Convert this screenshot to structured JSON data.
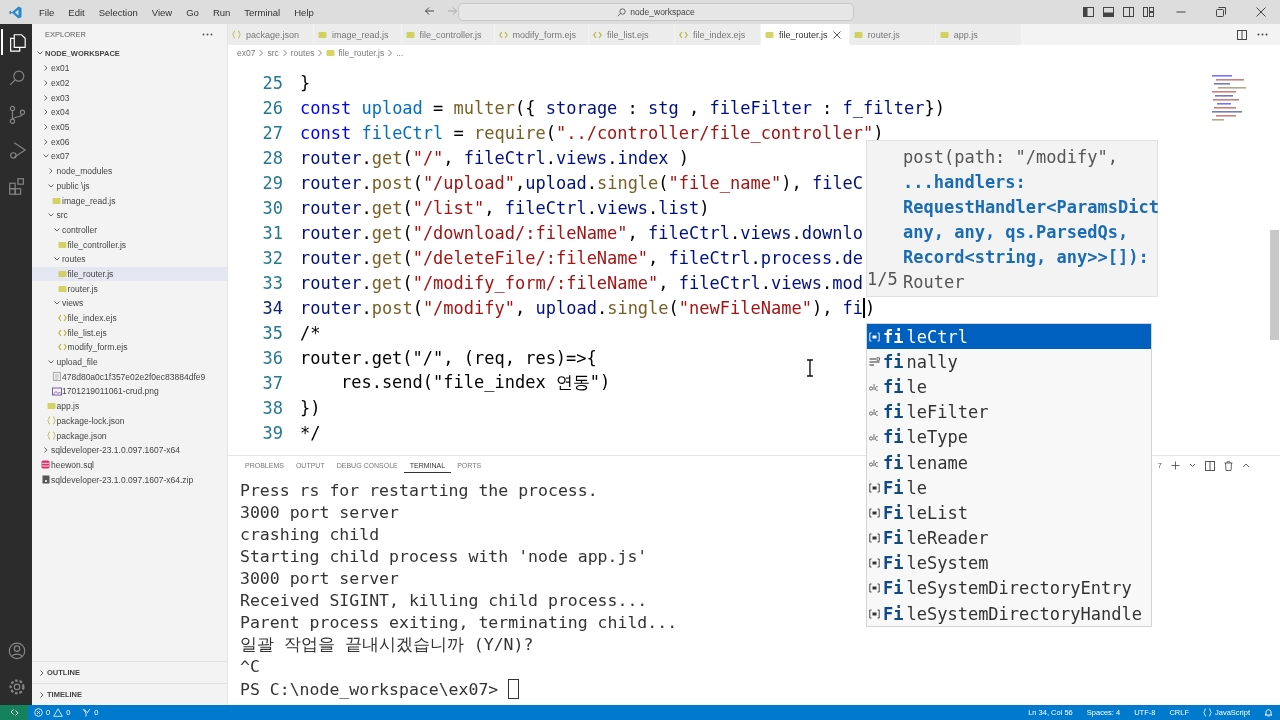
{
  "title_bar": {
    "menu": [
      "File",
      "Edit",
      "Selection",
      "View",
      "Go",
      "Run",
      "Terminal",
      "Help"
    ],
    "search": {
      "value": "node_workspace"
    }
  },
  "activity_bar": {
    "items": [
      {
        "kind": "explorer",
        "selected": true
      },
      {
        "kind": "search",
        "selected": false
      },
      {
        "kind": "source_control",
        "selected": false
      },
      {
        "kind": "run",
        "selected": false
      },
      {
        "kind": "extensions",
        "selected": false
      }
    ],
    "bottom": [
      {
        "kind": "account"
      },
      {
        "kind": "settings"
      }
    ]
  },
  "sidebar": {
    "title": "EXPLORER",
    "root": {
      "label": "NODE_WORKSPACE",
      "expanded": true
    },
    "tree": [
      {
        "label": "ex01",
        "kind": "folder",
        "expanded": false,
        "selected": false
      },
      {
        "label": "ex02",
        "kind": "folder",
        "expanded": false,
        "selected": false
      },
      {
        "label": "ex03",
        "kind": "folder",
        "expanded": false,
        "selected": false
      },
      {
        "label": "ex04",
        "kind": "folder",
        "expanded": false,
        "selected": false
      },
      {
        "label": "ex05",
        "kind": "folder",
        "expanded": false,
        "selected": false
      },
      {
        "label": "ex06",
        "kind": "folder",
        "expanded": false,
        "selected": false
      },
      {
        "label": "ex07",
        "kind": "folder",
        "expanded": true,
        "selected": false,
        "children": [
          {
            "label": "node_modules",
            "kind": "folder",
            "expanded": false,
            "selected": false
          },
          {
            "label": "public \\js",
            "kind": "folder",
            "expanded": true,
            "selected": false,
            "children": [
              {
                "label": "image_read.js",
                "kind": "js",
                "selected": false
              }
            ]
          },
          {
            "label": "src",
            "kind": "folder",
            "expanded": true,
            "selected": false,
            "children": [
              {
                "label": "controller",
                "kind": "folder",
                "expanded": true,
                "selected": false,
                "children": [
                  {
                    "label": "file_controller.js",
                    "kind": "js",
                    "selected": false
                  }
                ]
              },
              {
                "label": "routes",
                "kind": "folder",
                "expanded": true,
                "selected": false,
                "children": [
                  {
                    "label": "file_router.js",
                    "kind": "js",
                    "selected": true
                  },
                  {
                    "label": "router.js",
                    "kind": "js",
                    "selected": false
                  }
                ]
              },
              {
                "label": "views",
                "kind": "folder",
                "expanded": true,
                "selected": false,
                "children": [
                  {
                    "label": "file_index.ejs",
                    "kind": "ejs",
                    "selected": false
                  },
                  {
                    "label": "file_list.ejs",
                    "kind": "ejs",
                    "selected": false
                  },
                  {
                    "label": "modify_form.ejs",
                    "kind": "ejs",
                    "selected": false
                  }
                ]
              }
            ]
          },
          {
            "label": "upload_file",
            "kind": "folder",
            "expanded": true,
            "selected": false,
            "children": [
              {
                "label": "478d80a0c1f357e02e2f0ec83884dfe9",
                "kind": "text",
                "selected": false
              },
              {
                "label": "1701219011061-crud.png",
                "kind": "image",
                "selected": false
              }
            ]
          },
          {
            "label": "app.js",
            "kind": "js",
            "selected": false
          },
          {
            "label": "package-lock.json",
            "kind": "json",
            "selected": false
          },
          {
            "label": "package.json",
            "kind": "json",
            "selected": false
          }
        ]
      },
      {
        "label": "sqldeveloper-23.1.0.097.1607-x64",
        "kind": "folder",
        "expanded": false,
        "selected": false
      },
      {
        "label": "heewon.sql",
        "kind": "sql",
        "selected": false
      },
      {
        "label": "sqldeveloper-23.1.0.097.1607-x64.zip",
        "kind": "zip",
        "selected": false
      }
    ],
    "sections": [
      {
        "label": "OUTLINE",
        "expanded": false
      },
      {
        "label": "TIMELINE",
        "expanded": false
      }
    ]
  },
  "tabs": [
    {
      "label": "package.json",
      "kind": "json",
      "selected": false
    },
    {
      "label": "image_read.js",
      "kind": "js",
      "selected": false
    },
    {
      "label": "file_controller.js",
      "kind": "js",
      "selected": false
    },
    {
      "label": "modify_form.ejs",
      "kind": "ejs",
      "selected": false
    },
    {
      "label": "file_list.ejs",
      "kind": "ejs",
      "selected": false
    },
    {
      "label": "file_index.ejs",
      "kind": "ejs",
      "selected": false
    },
    {
      "label": "file_router.js",
      "kind": "js",
      "selected": true
    },
    {
      "label": "router.js",
      "kind": "js",
      "selected": false
    },
    {
      "label": "app.js",
      "kind": "js",
      "selected": false
    }
  ],
  "breadcrumb": [
    {
      "label": "ex07",
      "kind": "folder"
    },
    {
      "label": "src",
      "kind": "folder"
    },
    {
      "label": "routes",
      "kind": "folder"
    },
    {
      "label": "file_router.js",
      "kind": "js"
    },
    {
      "label": "...",
      "kind": "more"
    }
  ],
  "editor": {
    "lines": [
      {
        "number": "25",
        "tokens": [
          {
            "kind": "p",
            "text": "}"
          }
        ]
      },
      {
        "number": "26",
        "tokens": [
          {
            "kind": "kw",
            "text": "const"
          },
          {
            "kind": "var",
            "text": " upload"
          },
          {
            "kind": "p",
            "text": " = "
          },
          {
            "kind": "fn",
            "text": "multer"
          },
          {
            "kind": "p",
            "text": "({ "
          },
          {
            "kind": "prop",
            "text": "storage"
          },
          {
            "kind": "p",
            "text": " : "
          },
          {
            "kind": "prop",
            "text": "stg"
          },
          {
            "kind": "p",
            "text": " , "
          },
          {
            "kind": "prop",
            "text": "fileFilter"
          },
          {
            "kind": "p",
            "text": " : "
          },
          {
            "kind": "prop",
            "text": "f_filter"
          },
          {
            "kind": "p",
            "text": "})"
          }
        ]
      },
      {
        "number": "27",
        "tokens": [
          {
            "kind": "kw",
            "text": "const"
          },
          {
            "kind": "var",
            "text": " fileCtrl"
          },
          {
            "kind": "p",
            "text": " = "
          },
          {
            "kind": "fn",
            "text": "require"
          },
          {
            "kind": "p",
            "text": "("
          },
          {
            "kind": "str",
            "text": "\"../controller/file_controller\""
          },
          {
            "kind": "p",
            "text": ")"
          }
        ]
      },
      {
        "number": "28",
        "tokens": [
          {
            "kind": "prop",
            "text": "router"
          },
          {
            "kind": "p",
            "text": "."
          },
          {
            "kind": "fn",
            "text": "get"
          },
          {
            "kind": "p",
            "text": "("
          },
          {
            "kind": "str",
            "text": "\"/\""
          },
          {
            "kind": "p",
            "text": ", "
          },
          {
            "kind": "prop",
            "text": "fileCtrl"
          },
          {
            "kind": "p",
            "text": "."
          },
          {
            "kind": "prop",
            "text": "views"
          },
          {
            "kind": "p",
            "text": "."
          },
          {
            "kind": "prop",
            "text": "index"
          },
          {
            "kind": "p",
            "text": " )"
          }
        ]
      },
      {
        "number": "29",
        "tokens": [
          {
            "kind": "prop",
            "text": "router"
          },
          {
            "kind": "p",
            "text": "."
          },
          {
            "kind": "fn",
            "text": "post"
          },
          {
            "kind": "p",
            "text": "("
          },
          {
            "kind": "str",
            "text": "\"/upload\""
          },
          {
            "kind": "p",
            "text": ","
          },
          {
            "kind": "prop",
            "text": "upload"
          },
          {
            "kind": "p",
            "text": "."
          },
          {
            "kind": "fn",
            "text": "single"
          },
          {
            "kind": "p",
            "text": "("
          },
          {
            "kind": "str",
            "text": "\"file_name\""
          },
          {
            "kind": "p",
            "text": "), "
          },
          {
            "kind": "prop",
            "text": "fileC"
          }
        ]
      },
      {
        "number": "30",
        "tokens": [
          {
            "kind": "prop",
            "text": "router"
          },
          {
            "kind": "p",
            "text": "."
          },
          {
            "kind": "fn",
            "text": "get"
          },
          {
            "kind": "p",
            "text": "("
          },
          {
            "kind": "str",
            "text": "\"/list\""
          },
          {
            "kind": "p",
            "text": ", "
          },
          {
            "kind": "prop",
            "text": "fileCtrl"
          },
          {
            "kind": "p",
            "text": "."
          },
          {
            "kind": "prop",
            "text": "views"
          },
          {
            "kind": "p",
            "text": "."
          },
          {
            "kind": "prop",
            "text": "list"
          },
          {
            "kind": "p",
            "text": ")"
          }
        ]
      },
      {
        "number": "31",
        "tokens": [
          {
            "kind": "prop",
            "text": "router"
          },
          {
            "kind": "p",
            "text": "."
          },
          {
            "kind": "fn",
            "text": "get"
          },
          {
            "kind": "p",
            "text": "("
          },
          {
            "kind": "str",
            "text": "\"/download/:fileName\""
          },
          {
            "kind": "p",
            "text": ", "
          },
          {
            "kind": "prop",
            "text": "fileCtrl"
          },
          {
            "kind": "p",
            "text": "."
          },
          {
            "kind": "prop",
            "text": "views"
          },
          {
            "kind": "p",
            "text": "."
          },
          {
            "kind": "prop",
            "text": "downlo"
          }
        ]
      },
      {
        "number": "32",
        "tokens": [
          {
            "kind": "prop",
            "text": "router"
          },
          {
            "kind": "p",
            "text": "."
          },
          {
            "kind": "fn",
            "text": "get"
          },
          {
            "kind": "p",
            "text": "("
          },
          {
            "kind": "str",
            "text": "\"/deleteFile/:fileName\""
          },
          {
            "kind": "p",
            "text": ", "
          },
          {
            "kind": "prop",
            "text": "fileCtrl"
          },
          {
            "kind": "p",
            "text": "."
          },
          {
            "kind": "prop",
            "text": "process"
          },
          {
            "kind": "p",
            "text": "."
          },
          {
            "kind": "prop",
            "text": "de"
          }
        ]
      },
      {
        "number": "33",
        "tokens": [
          {
            "kind": "prop",
            "text": "router"
          },
          {
            "kind": "p",
            "text": "."
          },
          {
            "kind": "fn",
            "text": "get"
          },
          {
            "kind": "p",
            "text": "("
          },
          {
            "kind": "str",
            "text": "\"/modify_form/:fileName\""
          },
          {
            "kind": "p",
            "text": ", "
          },
          {
            "kind": "prop",
            "text": "fileCtrl"
          },
          {
            "kind": "p",
            "text": "."
          },
          {
            "kind": "prop",
            "text": "views"
          },
          {
            "kind": "p",
            "text": "."
          },
          {
            "kind": "prop",
            "text": "mod"
          }
        ]
      },
      {
        "number": "34",
        "tokens": [
          {
            "kind": "prop",
            "text": "router"
          },
          {
            "kind": "p",
            "text": "."
          },
          {
            "kind": "fn",
            "text": "post"
          },
          {
            "kind": "p",
            "text": "("
          },
          {
            "kind": "str",
            "text": "\"/modify\""
          },
          {
            "kind": "p",
            "text": ", "
          },
          {
            "kind": "prop",
            "text": "upload"
          },
          {
            "kind": "p",
            "text": "."
          },
          {
            "kind": "fn",
            "text": "single"
          },
          {
            "kind": "p",
            "text": "("
          },
          {
            "kind": "str",
            "text": "\"newFileName\""
          },
          {
            "kind": "p",
            "text": "), "
          },
          {
            "kind": "prop",
            "text": "fi",
            "caret": true
          },
          {
            "kind": "p",
            "text": ")"
          }
        ]
      },
      {
        "number": "35",
        "tokens": [
          {
            "kind": "p",
            "text": "/*"
          }
        ]
      },
      {
        "number": "36",
        "tokens": [
          {
            "kind": "p",
            "text": "router.get(\"/\", (req, res)=>{"
          }
        ]
      },
      {
        "number": "37",
        "tokens": [
          {
            "kind": "p",
            "text": "    res.send(\"file_index 연동\")"
          }
        ]
      },
      {
        "number": "38",
        "tokens": [
          {
            "kind": "p",
            "text": "})"
          }
        ]
      },
      {
        "number": "39",
        "tokens": [
          {
            "kind": "p",
            "text": "*/"
          }
        ]
      }
    ]
  },
  "hover": {
    "counter": "1/5",
    "lines": [
      {
        "kind": "plain",
        "text": "post(path: \"/modify\","
      },
      {
        "kind": "param",
        "text": "...handlers:"
      },
      {
        "kind": "param",
        "text": "RequestHandler<ParamsDict"
      },
      {
        "kind": "param",
        "text": "any, any, qs.ParsedQs,"
      },
      {
        "kind": "param",
        "text": "Record<string, any>>[]):"
      },
      {
        "kind": "plain",
        "text": "Router"
      }
    ]
  },
  "suggestions": [
    {
      "label": "**fi**leCtrl",
      "kind": "variable",
      "selected": true
    },
    {
      "label": "**fi**nally",
      "kind": "keyword",
      "selected": false
    },
    {
      "label": "**fi**le",
      "kind": "word",
      "selected": false
    },
    {
      "label": "**fi**leFilter",
      "kind": "word",
      "selected": false
    },
    {
      "label": "**fi**leType",
      "kind": "word",
      "selected": false
    },
    {
      "label": "**fi**lename",
      "kind": "word",
      "selected": false
    },
    {
      "label": "**Fi**le",
      "kind": "variable",
      "selected": false
    },
    {
      "label": "**Fi**leList",
      "kind": "variable",
      "selected": false
    },
    {
      "label": "**Fi**leReader",
      "kind": "variable",
      "selected": false
    },
    {
      "label": "**Fi**leSystem",
      "kind": "variable",
      "selected": false
    },
    {
      "label": "**Fi**leSystemDirectoryEntry",
      "kind": "variable",
      "selected": false
    },
    {
      "label": "**Fi**leSystemDirectoryHandle",
      "kind": "variable",
      "selected": false
    }
  ],
  "panel": {
    "tabs": [
      {
        "label": "PROBLEMS",
        "selected": false
      },
      {
        "label": "OUTPUT",
        "selected": false
      },
      {
        "label": "DEBUG CONSOLE",
        "selected": false
      },
      {
        "label": "TERMINAL",
        "selected": true
      },
      {
        "label": "PORTS",
        "selected": false
      }
    ],
    "terminal_name": "7",
    "terminal": {
      "lines": [
        "Press rs for restarting the process.",
        "3000 port server",
        "crashing child",
        "Starting child process with 'node app.js'",
        "3000 port server",
        "Received SIGINT, killing child process...",
        "Parent process exiting, terminating child...",
        "일괄 작업을 끝내시겠습니까 (Y/N)?",
        "^C"
      ],
      "prompt": "PS C:\\node_workspace\\ex07>"
    }
  },
  "status_bar": {
    "errors": "0",
    "warnings": "0",
    "ports": "0",
    "items": [
      "Ln 34, Col 56",
      "Spaces: 4",
      "UTF-8",
      "CRLF"
    ],
    "language": "JavaScript"
  }
}
